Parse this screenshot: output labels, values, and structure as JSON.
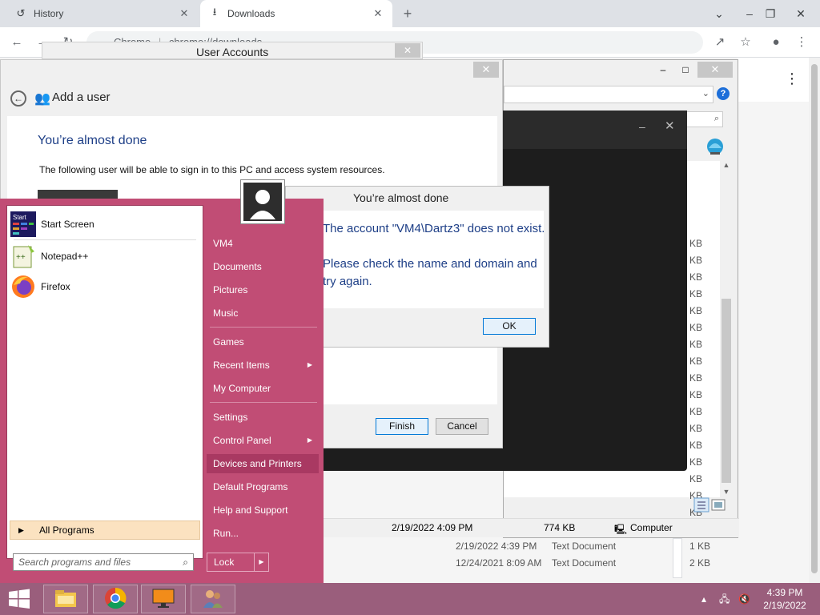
{
  "chrome": {
    "tabs": [
      {
        "label": "History",
        "icon": "history-icon"
      },
      {
        "label": "Downloads",
        "icon": "download-icon"
      }
    ],
    "url_scheme": "Chrome",
    "url": "chrome://downloads"
  },
  "user_accounts": {
    "window_title": "User Accounts",
    "header": "Add a user",
    "heading": "You’re almost done",
    "description": "The following user will be able to sign in to this PC and access system resources.",
    "finish_label": "Finish",
    "cancel_label": "Cancel"
  },
  "error_dialog": {
    "title": "You’re almost done",
    "message_line1": "The account \"VM4\\Dartz3\" does not exist.",
    "message_line2": "Please check the name and domain and try again.",
    "ok_label": "OK"
  },
  "explorer": {
    "file_sizes": [
      "KB",
      "KB",
      "KB",
      "KB",
      "KB",
      "KB",
      "KB",
      "KB",
      "KB",
      "KB",
      "KB",
      "KB",
      "KB",
      "KB",
      "KB",
      "KB",
      "KB",
      "KB",
      "1 KB",
      "2 KB"
    ],
    "files": [
      {
        "date": "2/19/2022 4:39 PM",
        "type": "Text Document",
        "size": "1 KB"
      },
      {
        "date": "12/24/2021 8:09 AM",
        "type": "Text Document",
        "size": "2 KB"
      }
    ],
    "status": {
      "date": "2/19/2022 4:09 PM",
      "size": "774 KB",
      "location": "Computer"
    }
  },
  "start_menu": {
    "pinned": [
      {
        "label": "Start Screen",
        "icon": "start-screen-icon"
      },
      {
        "label": "Notepad++",
        "icon": "notepadpp-icon"
      },
      {
        "label": "Firefox",
        "icon": "firefox-icon"
      }
    ],
    "all_programs": "All Programs",
    "search_placeholder": "Search programs and files",
    "right_items": [
      {
        "label": "VM4"
      },
      {
        "label": "Documents"
      },
      {
        "label": "Pictures"
      },
      {
        "label": "Music"
      },
      {
        "label": "Games"
      },
      {
        "label": "Recent Items"
      },
      {
        "label": "My Computer"
      },
      {
        "label": "Settings"
      },
      {
        "label": "Control Panel"
      },
      {
        "label": "Devices and Printers"
      },
      {
        "label": "Default Programs"
      },
      {
        "label": "Help and Support"
      },
      {
        "label": "Run..."
      }
    ],
    "lock_label": "Lock"
  },
  "taskbar": {
    "time": "4:39 PM",
    "date": "2/19/2022"
  },
  "colors": {
    "start_menu": "#c14d75",
    "taskbar": "#9a5e7c",
    "dialog_text": "#1e3f87"
  }
}
